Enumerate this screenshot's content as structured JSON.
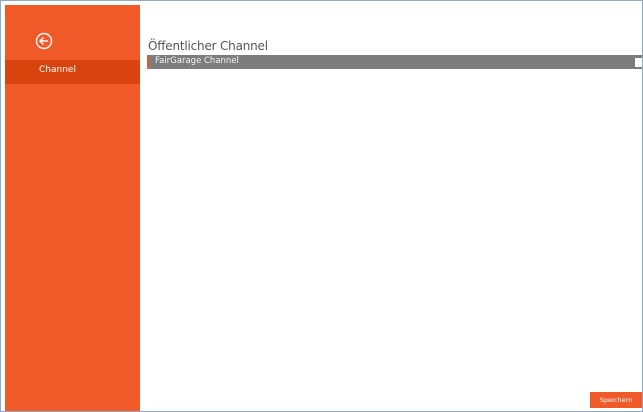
{
  "sidebar": {
    "back_icon": "back-arrow-circle-icon",
    "items": [
      {
        "label": "Channel",
        "selected": true
      }
    ]
  },
  "main": {
    "title": "Öffentlicher Channel",
    "channels": [
      {
        "label": "FairGarage Channel",
        "checked": false
      }
    ],
    "save_label": "Speichern"
  },
  "colors": {
    "accent": "#f05a28",
    "accent_dark": "#d9430e",
    "row_background": "#7d7d7d"
  }
}
